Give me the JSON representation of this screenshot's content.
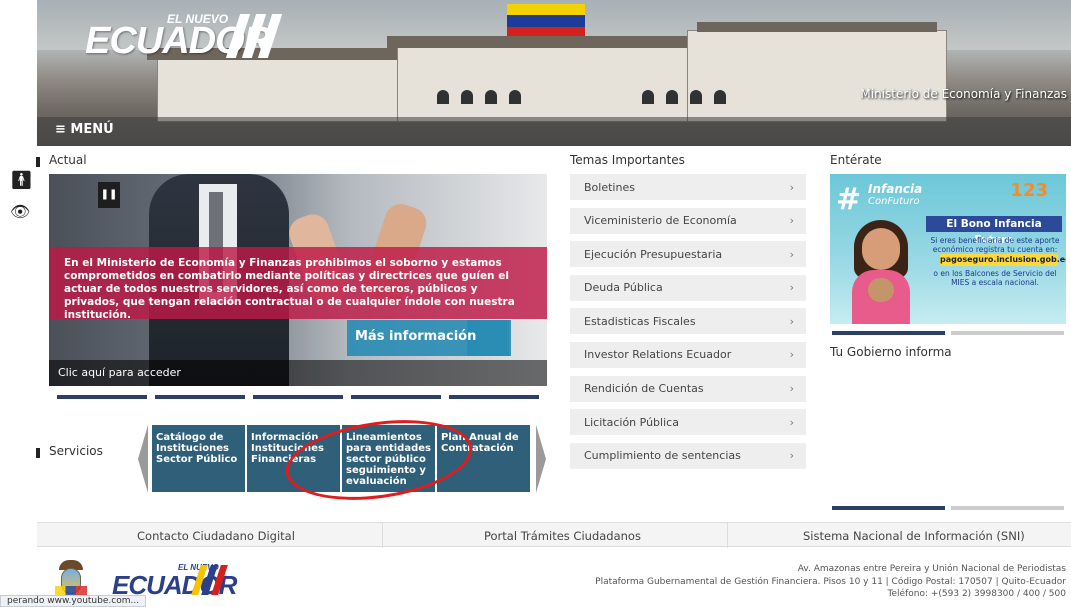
{
  "header": {
    "logo_small": "EL NUEVO",
    "logo_text": "ECUADOR",
    "ministry": "Ministerio de Economía y Finanzas",
    "menu_label": "≡ MENÚ"
  },
  "sections": {
    "actual": "Actual",
    "servicios": "Servicios",
    "temas": "Temas Importantes",
    "enterate": "Entérate",
    "gobierno": "Tu Gobierno informa"
  },
  "carousel": {
    "pause_icon": "❚❚",
    "text": "En el Ministerio de Economía y Finanzas prohibimos el soborno y estamos comprometidos en combatirlo mediante políticas y directrices que guíen el actuar de todos nuestros servidores, así como de terceros, públicos y privados, que tengan relación contractual o de cualquier índole con nuestra institución.",
    "more_button": "Más información",
    "access_link": "Clic aquí para acceder",
    "slides_total": 5
  },
  "servicios": [
    "Catálogo de Instituciones Sector Público",
    "Información Instituciones Financieras",
    "Lineamientos para entidades sector público seguimiento y evaluación",
    "Plan Anual de Contratación"
  ],
  "temas": [
    "Boletines",
    "Viceministerio de Economía",
    "Ejecución Presupuestaria",
    "Deuda Pública",
    "Estadisticas Fiscales",
    "Investor Relations Ecuador",
    "Rendición de Cuentas",
    "Licitación Pública",
    "Cumplimiento de sentencias"
  ],
  "temas_chevron": "›",
  "enterate_banner": {
    "hash": "#",
    "line1": "Infancia",
    "line2": "ConFuturo",
    "numbers": "123",
    "badge": "El Bono Infancia Futuro",
    "text1": "Si eres beneficiaria de este aporte económico registra tu cuenta en:",
    "url": "pagoseguro.inclusion.gob.ec",
    "text2": "o en los Balcones de Servicio del MIES a escala nacional."
  },
  "links": [
    "Contacto Ciudadano Digital",
    "Portal Trámites Ciudadanos",
    "Sistema Nacional de Información (SNI)"
  ],
  "footer": {
    "logo_small": "EL NUEVO",
    "logo_text": "ECUADOR",
    "address1": "Av. Amazonas entre Pereira y Unión Nacional de Periodistas",
    "address2": "Plataforma Gubernamental de Gestión Financiera. Pisos 10 y 11 | Código Postal: 170507 | Quito-Ecuador",
    "phone": "Teléfono: +(593 2) 3998300 / 400 / 500"
  },
  "status_bar": "perando www.youtube.com...",
  "colors": {
    "tile": "#2f5f79",
    "band": "#be1846",
    "indicator": "#2b3f6a",
    "annotation_circle": "#e01c1c"
  }
}
